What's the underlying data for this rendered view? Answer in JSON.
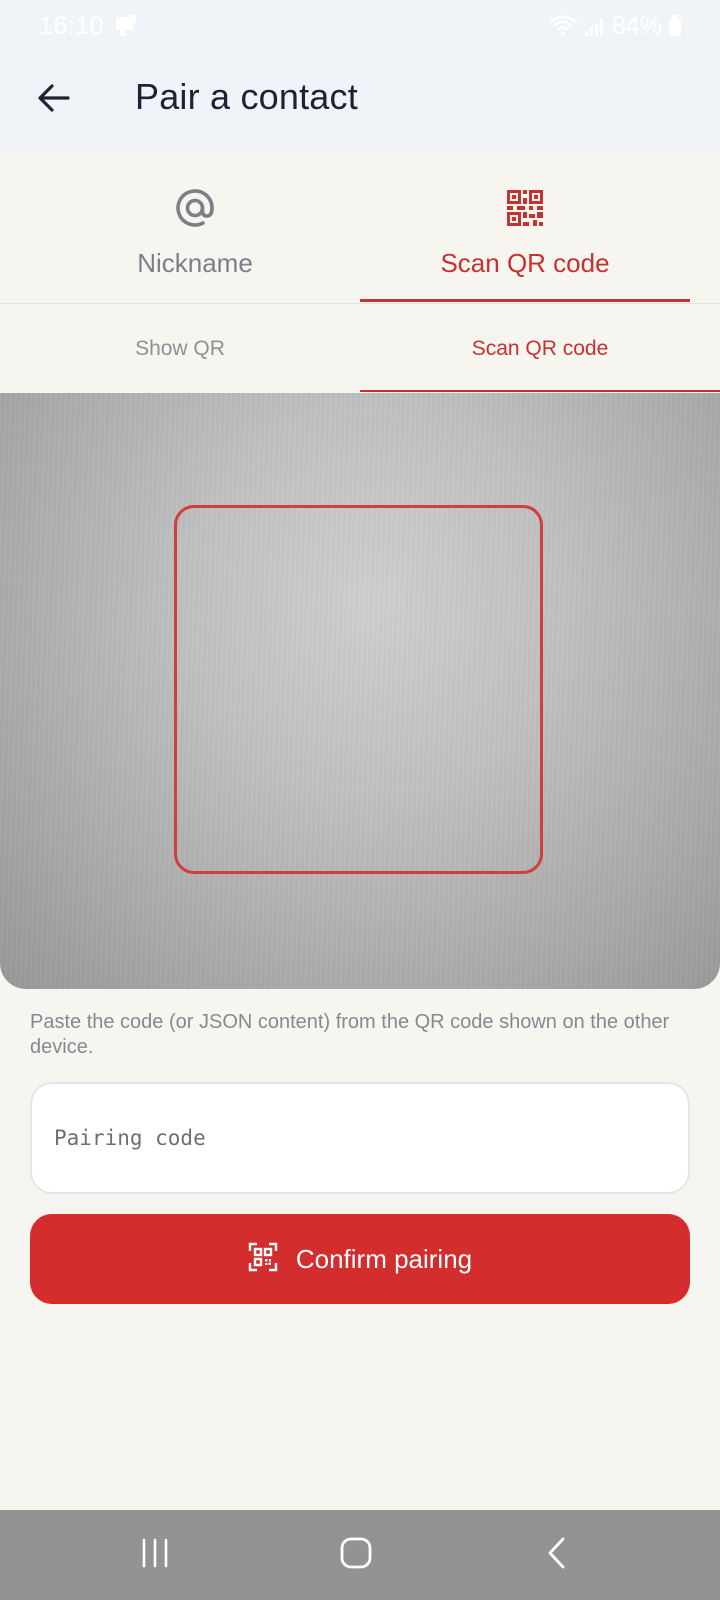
{
  "status_bar": {
    "time": "16:10",
    "battery": "84%",
    "icons": [
      "notification-icon",
      "wifi-icon",
      "signal-icon",
      "battery-icon"
    ]
  },
  "app_bar": {
    "title": "Pair a contact",
    "back_icon": "arrow-left-icon"
  },
  "primary_tabs": [
    {
      "label": "Nickname",
      "icon": "at-sign-icon",
      "selected": false
    },
    {
      "label": "Scan QR code",
      "icon": "qr-code-icon",
      "selected": true
    }
  ],
  "secondary_tabs": [
    {
      "label": "Show QR",
      "selected": false
    },
    {
      "label": "Scan QR code",
      "selected": true
    }
  ],
  "scanner": {
    "instructions": "Paste the code (or JSON content) from the QR code shown on the other device."
  },
  "pairing_input": {
    "placeholder": "Pairing code",
    "value": ""
  },
  "confirm_button": {
    "label": "Confirm pairing",
    "icon": "qr-scan-icon"
  },
  "nav_bar": {
    "icons": [
      "recents-icon",
      "home-icon",
      "back-icon"
    ]
  },
  "colors": {
    "accent": "#d32d2d",
    "header_bg": "#f0f3f7",
    "page_bg": "#f7f5f0",
    "nav_bg": "#939393"
  }
}
